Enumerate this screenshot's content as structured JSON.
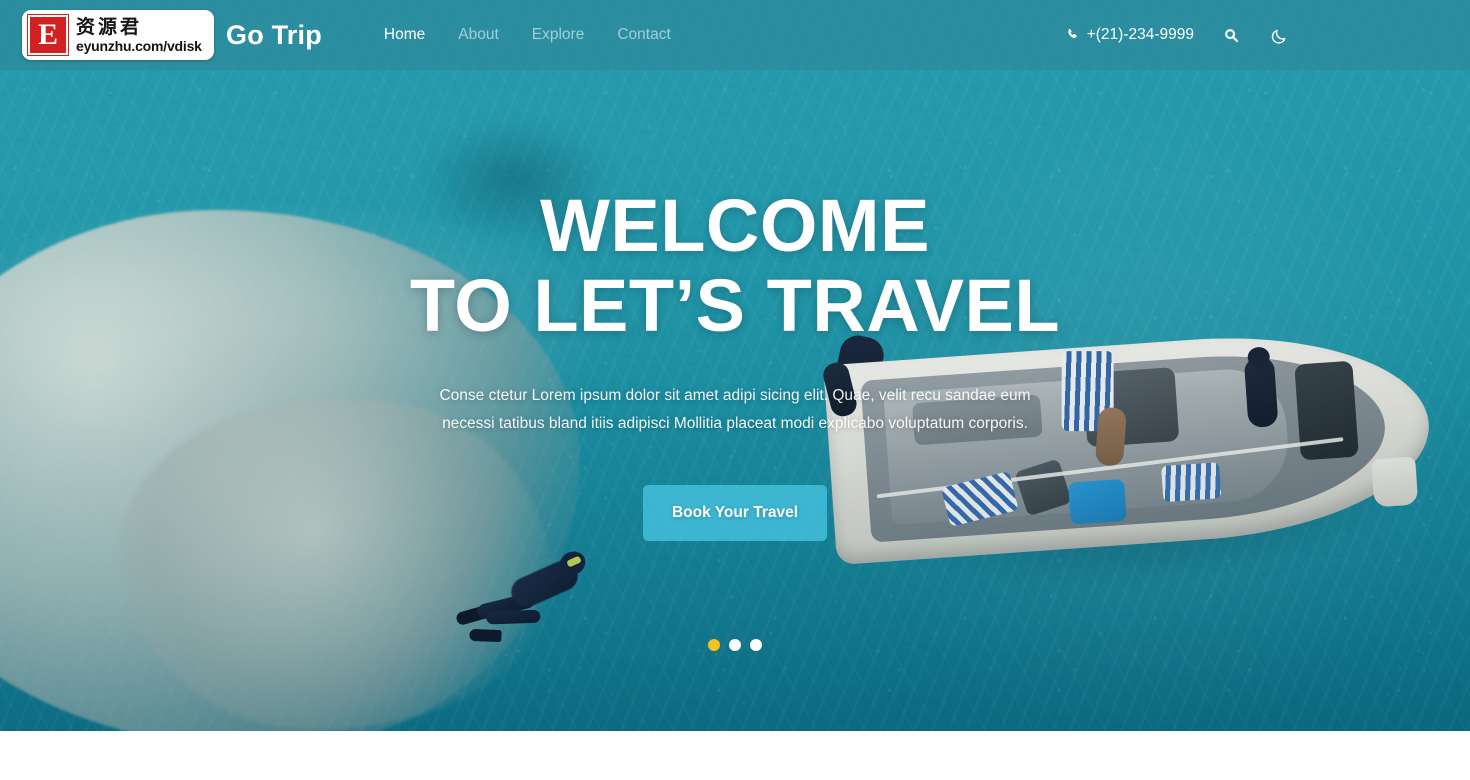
{
  "header": {
    "watermark": {
      "badge_letter": "E",
      "cn_text": "资源君",
      "url_text": "eyunzhu.com/vdisk"
    },
    "site_title": "Go Trip",
    "nav": [
      {
        "label": "Home",
        "active": true
      },
      {
        "label": "About",
        "active": false
      },
      {
        "label": "Explore",
        "active": false
      },
      {
        "label": "Contact",
        "active": false
      }
    ],
    "phone": "+(21)-234-9999",
    "phone_icon": "phone-icon",
    "search_icon": "search-icon",
    "theme_icon": "moon-icon",
    "background_color": "#2c8c9e"
  },
  "hero": {
    "title_line1": "WELCOME",
    "title_line2": "TO LET’S TRAVEL",
    "subtitle": "Conse ctetur Lorem ipsum dolor sit amet adipi sicing elit. Quae, velit recu sandae eum necessi tatibus bland itiis adipisci Mollitia placeat modi explicabo voluptatum corporis.",
    "cta_label": "Book Your Travel",
    "cta_color": "#46c4e2",
    "carousel": {
      "slides": 3,
      "active_index": 0,
      "active_color": "#f4c220",
      "inactive_color": "#ffffff"
    },
    "image_alt": "Aerial view of a white motorboat with travelers on turquoise water beside a coral reef, with a snorkeler swimming nearby"
  }
}
